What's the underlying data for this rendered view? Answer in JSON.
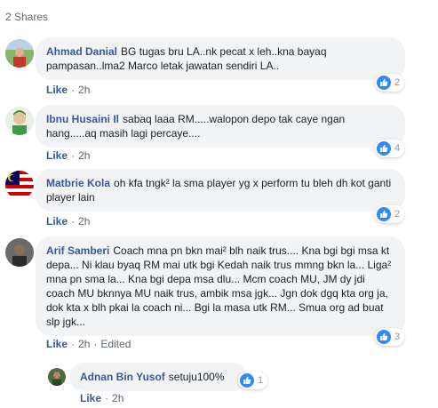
{
  "shares": "2 Shares",
  "comments": [
    {
      "author": "Ahmad Danial",
      "text": "BG tugas bru LA..nk pecat x leh..kna bayaq pampasan..lma2 Marco letak jawatan sendiri LA..",
      "like_label": "Like",
      "time": "2h",
      "reactions": "2",
      "avatar_color": "#4a7a3a"
    },
    {
      "author": "Ibnu Husaini Il",
      "text": "sabaq laaa RM.....walopon depo tak caye ngan hang.....aq masih lagi percaye....",
      "like_label": "Like",
      "time": "2h",
      "reactions": "4",
      "avatar_color": "#5aa05a"
    },
    {
      "author": "Matbrie Kola",
      "text": "oh kfa tngk² la sma player yg x perform tu bleh dh kot ganti player lain",
      "like_label": "Like",
      "time": "2h",
      "reactions": "2",
      "avatar_color": "#c0392b"
    },
    {
      "author": "Arif Samberi",
      "text": "Coach mna pn bkn mai² blh naik trus.... Kna bgi bgi msa kt depa... Ni klau byaq RM mai utk bgi Kedah naik trus mmng bkn la... Liga² mna pn sma la... Kna bgi depa msa dlu... Mcm coach MU, JM dy jdi coach MU bknnya MU naik trus, ambik msa jgk... Jgn dok dgq kta org ja, dok kta x blh pkai la coach ni... Bgi la masa utk RM... Smua org ad buat slp jgk...",
      "like_label": "Like",
      "time": "2h",
      "edited": "Edited",
      "reactions": "3",
      "avatar_color": "#555555"
    }
  ],
  "reply": {
    "author": "Adnan Bin Yusof",
    "text": "setuju100%",
    "like_label": "Like",
    "time": "2h",
    "reactions": "1",
    "avatar_color": "#3d5a2a"
  },
  "colors": {
    "link": "#385898",
    "bubble": "#f2f3f5",
    "like_blue": "#2e89ff",
    "meta": "#606770"
  }
}
